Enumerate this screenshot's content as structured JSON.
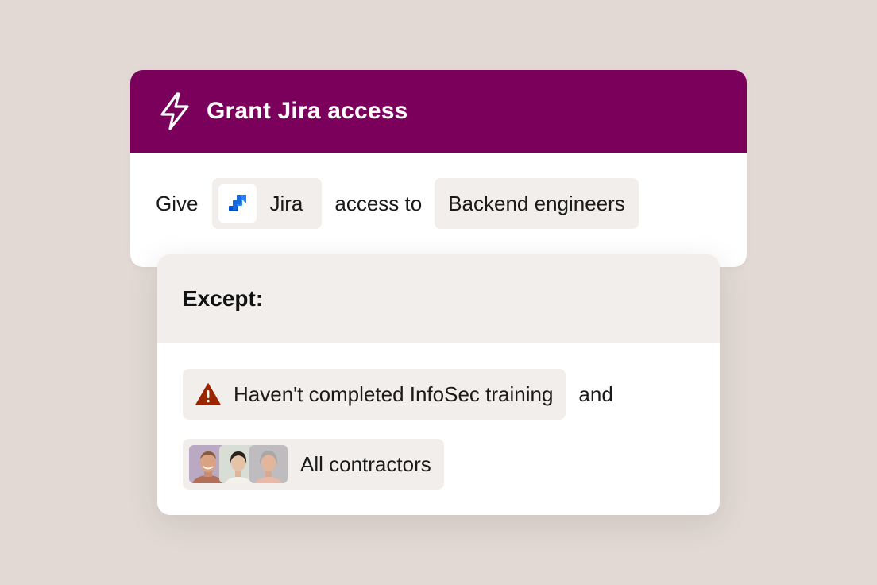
{
  "workflow": {
    "title": "Grant Jira access",
    "icon": "lightning-bolt-icon",
    "header_color": "#7a005c"
  },
  "rule": {
    "give_label": "Give",
    "app": {
      "name": "Jira",
      "icon": "jira-logo-icon"
    },
    "access_to_label": "access to",
    "group": "Backend engineers"
  },
  "exceptions": {
    "title": "Except:",
    "conditions": [
      {
        "icon": "warning-triangle-icon",
        "label": "Haven't completed InfoSec training",
        "accent": "#9a2500"
      },
      {
        "icon": "avatar-group",
        "label": "All contractors"
      }
    ],
    "joiner": "and"
  }
}
